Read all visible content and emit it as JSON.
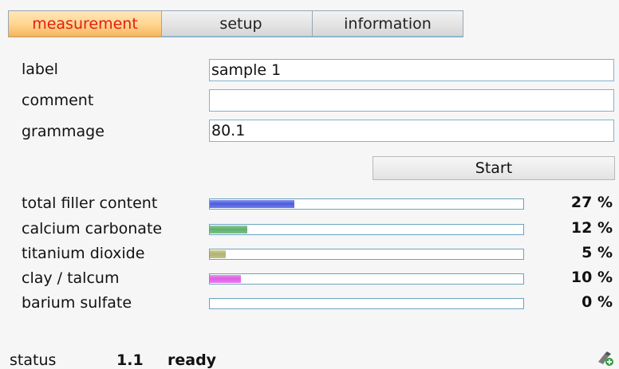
{
  "tabs": [
    {
      "label": "measurement",
      "active": true
    },
    {
      "label": "setup",
      "active": false
    },
    {
      "label": "information",
      "active": false
    }
  ],
  "form": {
    "label_label": "label",
    "label_value": "sample 1",
    "comment_label": "comment",
    "comment_value": "",
    "grammage_label": "grammage",
    "grammage_value": "80.1"
  },
  "start_label": "Start",
  "results": [
    {
      "name": "total filler content",
      "percent": 27,
      "percent_text": "27 %",
      "color": "#4c5de0"
    },
    {
      "name": "calcium carbonate",
      "percent": 12,
      "percent_text": "12 %",
      "color": "#5fae6a"
    },
    {
      "name": "titanium dioxide",
      "percent": 5,
      "percent_text": "5 %",
      "color": "#b3b36f"
    },
    {
      "name": "clay / talcum",
      "percent": 10,
      "percent_text": "10 %",
      "color": "#e05ce6"
    },
    {
      "name": "barium sulfate",
      "percent": 0,
      "percent_text": "0 %",
      "color": "#888888"
    }
  ],
  "status": {
    "label": "status",
    "code": "1.1",
    "text": "ready",
    "icon": "usb-connected-icon"
  },
  "colors": {
    "active_tab_text": "#e21e12",
    "field_border": "#82b4c9"
  }
}
